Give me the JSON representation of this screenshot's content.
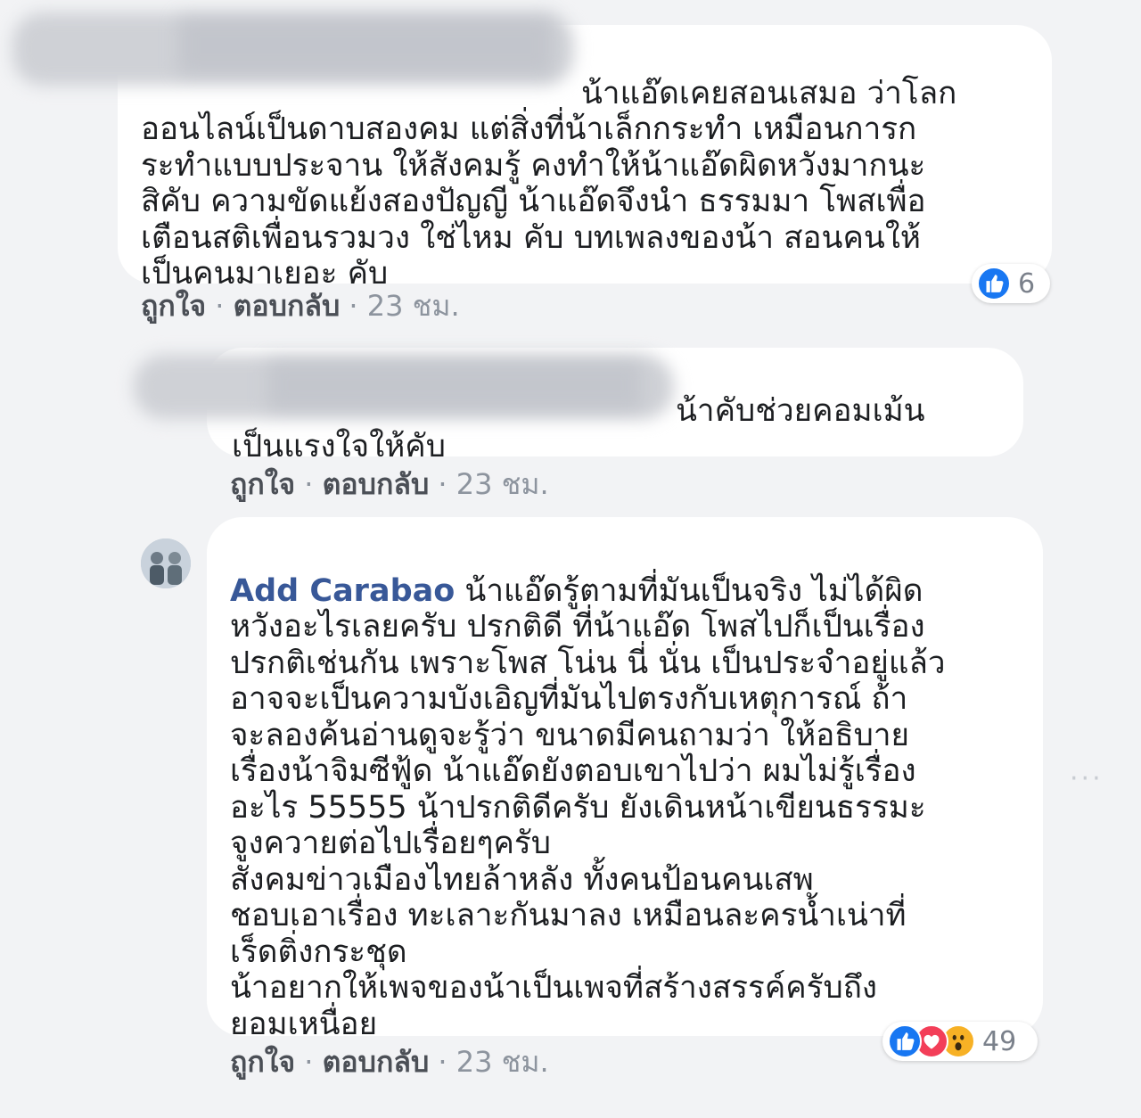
{
  "comments": [
    {
      "author": "",
      "text": "น้าแอ๊ดเคยสอนเสมอ ว่าโลก\nออนไลน์เป็นดาบสองคม แต่สิ่งที่น้าเล็กกระทำ เหมือนการก\nระทำแบบประจาน ให้สังคมรู้ คงทำให้น้าแอ๊ดผิดหวังมากนะ\nสิคับ ความขัดแย้งสองปัญญี น้าแอ๊ดจึงนำ ธรรมมา โพสเพื่อ\nเตือนสติเพื่อนรวมวง ใช่ไหม คับ บทเพลงของน้า สอนคนให้\nเป็นคนมาเยอะ คับ",
      "like_label": "ถูกใจ",
      "reply_label": "ตอบกลับ",
      "time": "23 ชม.",
      "reaction_count": "6",
      "reactions": [
        "like-icon"
      ]
    },
    {
      "author": "",
      "text": "น้าคับช่วยคอมเม้น\nเป็นแรงใจให้คับ",
      "like_label": "ถูกใจ",
      "reply_label": "ตอบกลับ",
      "time": "23 ชม."
    },
    {
      "author": "Add Carabao",
      "text": "น้าแอ๊ดรู้ตามที่มันเป็นจริง ไม่ได้ผิด\nหวังอะไรเลยครับ ปรกติดี ที่น้าแอ๊ด โพสไปก็เป็นเรื่อง\nปรกติเช่นกัน เพราะโพส โน่น นี่ นั่น เป็นประจำอยู่แล้ว\nอาจจะเป็นความบังเอิญที่มันไปตรงกับเหตุการณ์ ถ้า\nจะลองค้นอ่านดูจะรู้ว่า ขนาดมีคนถามว่า ให้อธิบาย\nเรื่องน้าจิมซีฟู้ด น้าแอ๊ดยังตอบเขาไปว่า ผมไม่รู้เรื่อง\nอะไร 55555 น้าปรกติดีครับ ยังเดินหน้าเขียนธรรมะ\nจูงควายต่อไปเรื่อยๆครับ\nสังคมข่าวเมืองไทยล้าหลัง ทั้งคนป้อนคนเสพ\nชอบเอาเรื่อง ทะเลาะกันมาลง เหมือนละครน้ำเน่าที่\nเร็ดติ่งกระชุด\nน้าอยากให้เพจของน้าเป็นเพจที่สร้างสรรค์ครับถึง\nยอมเหนื่อย",
      "like_label": "ถูกใจ",
      "reply_label": "ตอบกลับ",
      "time": "23 ชม.",
      "reaction_count": "49",
      "reactions": [
        "like-icon",
        "love-icon",
        "wow-icon"
      ]
    }
  ],
  "separator": "·",
  "more_label": "···",
  "colors": {
    "page_bg": "#f2f3f5",
    "bubble_bg": "#ffffff",
    "author": "#385898",
    "meta": "#8d949e",
    "like_blue": "#1877f2",
    "love_red": "#f33e58",
    "wow_yellow": "#f7b125"
  }
}
